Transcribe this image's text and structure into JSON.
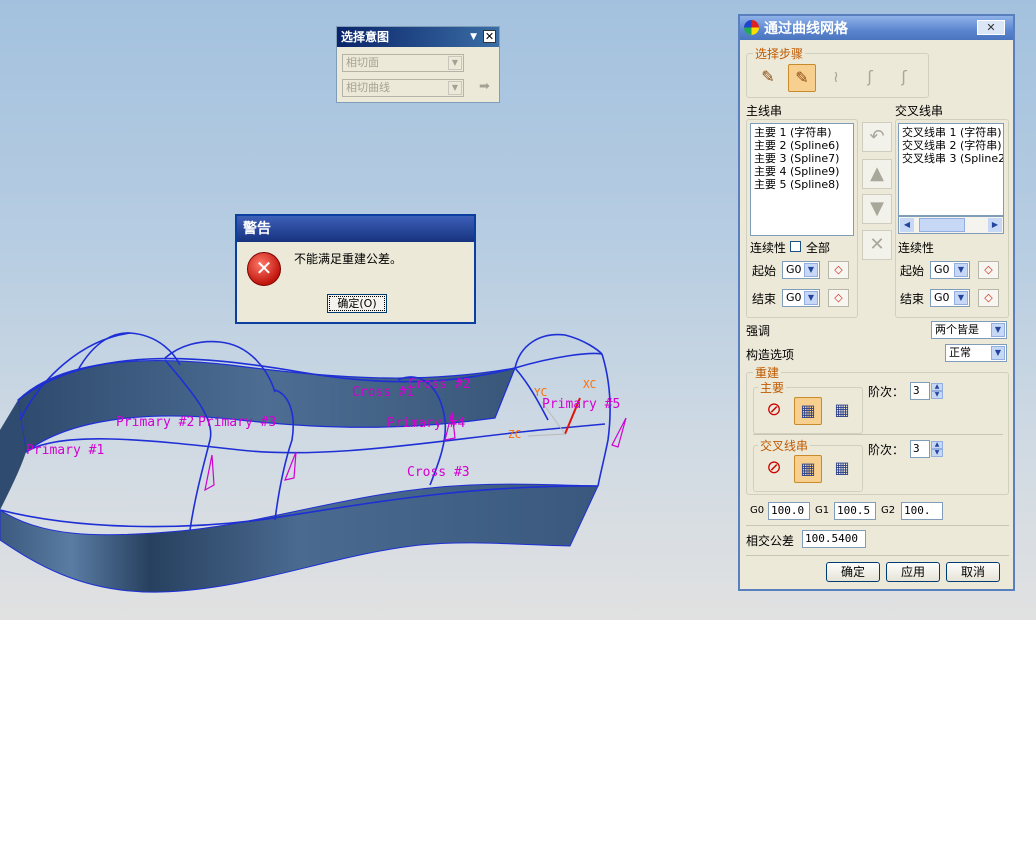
{
  "viewport": {
    "labels": {
      "primary1": "Primary #1",
      "primary2": "Primary #2",
      "primary3": "Primary #3",
      "primary4": "Primary #4",
      "primary5": "Primary #5",
      "cross1": "Cross #1",
      "cross2": "Cross #2",
      "cross3": "Cross #3"
    },
    "axes": {
      "yc": "YC",
      "xc": "XC",
      "zc": "ZC"
    }
  },
  "selection_intent": {
    "title": "选择意图",
    "face_rule": "相切面",
    "curve_rule": "相切曲线"
  },
  "warning": {
    "title": "警告",
    "message": "不能满足重建公差。",
    "ok_label": "确定(O)"
  },
  "dialog": {
    "title": "通过曲线网格",
    "steps_label": "选择步骤",
    "primary_label": "主线串",
    "cross_label": "交叉线串",
    "primary_items": [
      "主要 1 (字符串)",
      "主要 2 (Spline6)",
      "主要 3 (Spline7)",
      "主要 4 (Spline9)",
      "主要 5 (Spline8)"
    ],
    "cross_items": [
      "交叉线串 1 (字符串)",
      "交叉线串 2 (字符串)",
      "交叉线串 3 (Spline2)"
    ],
    "continuity_label": "连续性",
    "all_label": "全部",
    "start_label": "起始",
    "end_label": "结束",
    "g0": "G0",
    "emphasis_label": "强调",
    "emphasis_value": "两个皆是",
    "construction_label": "构造选项",
    "construction_value": "正常",
    "rebuild_label": "重建",
    "rebuild_primary_label": "主要",
    "rebuild_cross_label": "交叉线串",
    "degree_label": "阶次：",
    "primary_degree": "3",
    "cross_degree": "3",
    "g0_tol_label": "G0",
    "g0_tol": "100.0",
    "g1_tol_label": "G1",
    "g1_tol": "100.5",
    "g2_tol_label": "G2",
    "g2_tol": "100.",
    "intersection_tol_label": "相交公差",
    "intersection_tol": "100.5400",
    "ok_label": "确定",
    "apply_label": "应用",
    "cancel_label": "取消"
  },
  "colors": {
    "surface": "#4a6a90",
    "curve": "#1e2fd6",
    "label": "#d200d2",
    "axis": "#ff6a00",
    "title_blue": "#0a246a"
  }
}
